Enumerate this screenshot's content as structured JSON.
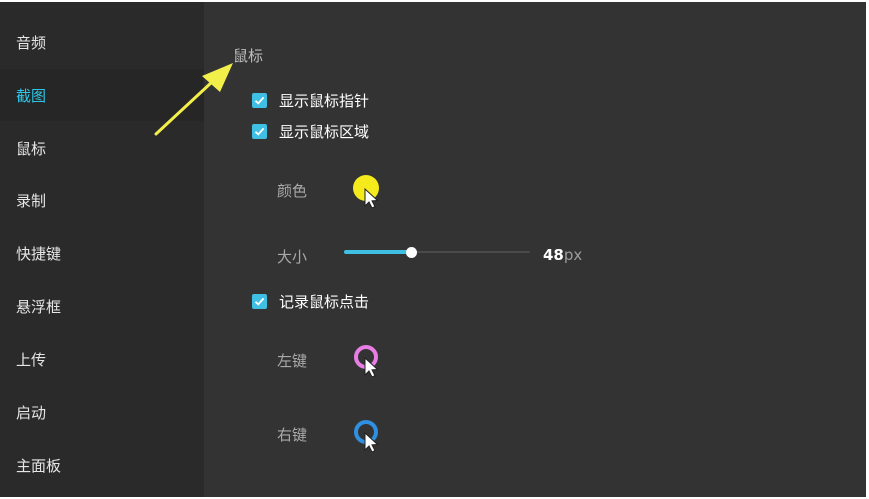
{
  "sidebar": {
    "items": [
      {
        "label": "音频"
      },
      {
        "label": "截图"
      },
      {
        "label": "鼠标"
      },
      {
        "label": "录制"
      },
      {
        "label": "快捷键"
      },
      {
        "label": "悬浮框"
      },
      {
        "label": "上传"
      },
      {
        "label": "启动"
      },
      {
        "label": "主面板"
      }
    ],
    "active": "截图"
  },
  "mouse_settings": {
    "title": "鼠标",
    "show_pointer": {
      "label": "显示鼠标指针",
      "checked": true
    },
    "show_area": {
      "label": "显示鼠标区域",
      "checked": true
    },
    "color": {
      "label": "颜色",
      "value": "#f5ea1c"
    },
    "size": {
      "label": "大小",
      "value": "48",
      "unit": "px",
      "fraction": 0.36
    },
    "record_clicks": {
      "label": "记录鼠标点击",
      "checked": true
    },
    "left_click": {
      "label": "左键",
      "color": "#e87de6"
    },
    "right_click": {
      "label": "右键",
      "color": "#2f8fe0"
    }
  },
  "colors": {
    "accent": "#3fbfe3",
    "annotation_arrow": "#f2ee4a"
  }
}
